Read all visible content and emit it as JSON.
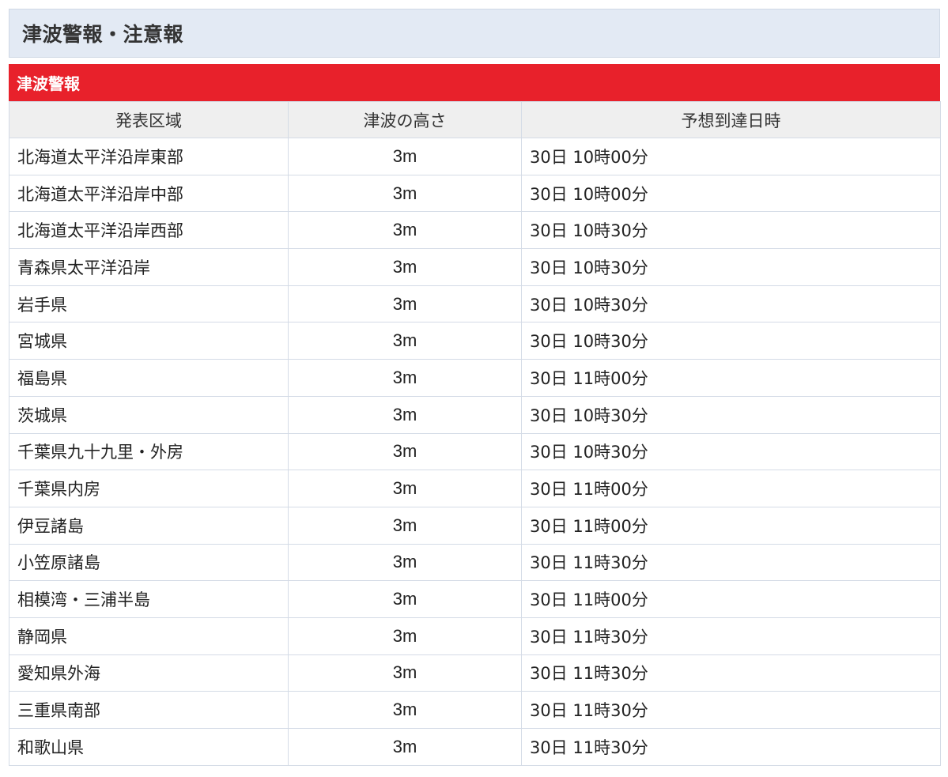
{
  "section": {
    "title": "津波警報・注意報"
  },
  "warning": {
    "title": "津波警報"
  },
  "table": {
    "headers": [
      "発表区域",
      "津波の高さ",
      "予想到達日時"
    ],
    "rows": [
      {
        "area": "北海道太平洋沿岸東部",
        "height": "3m",
        "arrival": "30日 10時00分"
      },
      {
        "area": "北海道太平洋沿岸中部",
        "height": "3m",
        "arrival": "30日 10時00分"
      },
      {
        "area": "北海道太平洋沿岸西部",
        "height": "3m",
        "arrival": "30日 10時30分"
      },
      {
        "area": "青森県太平洋沿岸",
        "height": "3m",
        "arrival": "30日 10時30分"
      },
      {
        "area": "岩手県",
        "height": "3m",
        "arrival": "30日 10時30分"
      },
      {
        "area": "宮城県",
        "height": "3m",
        "arrival": "30日 10時30分"
      },
      {
        "area": "福島県",
        "height": "3m",
        "arrival": "30日 11時00分"
      },
      {
        "area": "茨城県",
        "height": "3m",
        "arrival": "30日 10時30分"
      },
      {
        "area": "千葉県九十九里・外房",
        "height": "3m",
        "arrival": "30日 10時30分"
      },
      {
        "area": "千葉県内房",
        "height": "3m",
        "arrival": "30日 11時00分"
      },
      {
        "area": "伊豆諸島",
        "height": "3m",
        "arrival": "30日 11時00分"
      },
      {
        "area": "小笠原諸島",
        "height": "3m",
        "arrival": "30日 11時30分"
      },
      {
        "area": "相模湾・三浦半島",
        "height": "3m",
        "arrival": "30日 11時00分"
      },
      {
        "area": "静岡県",
        "height": "3m",
        "arrival": "30日 11時30分"
      },
      {
        "area": "愛知県外海",
        "height": "3m",
        "arrival": "30日 11時30分"
      },
      {
        "area": "三重県南部",
        "height": "3m",
        "arrival": "30日 11時30分"
      },
      {
        "area": "和歌山県",
        "height": "3m",
        "arrival": "30日 11時30分"
      }
    ]
  },
  "colors": {
    "section_bg": "#e3eaf4",
    "warning_red": "#e8212b",
    "header_bg": "#efefef",
    "border": "#d4dbe6"
  }
}
